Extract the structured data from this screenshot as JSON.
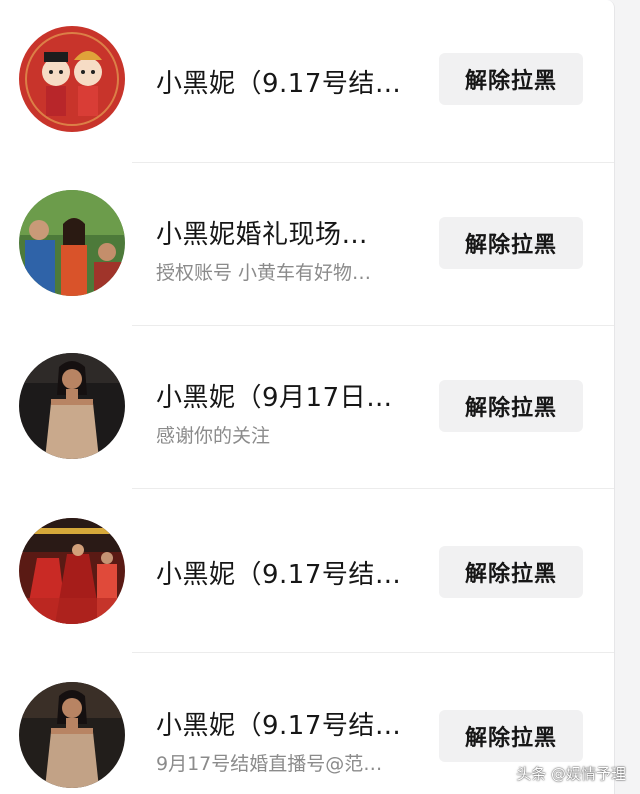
{
  "block_list": {
    "items": [
      {
        "name": "小黑妮（9.17号结…",
        "subtitle": "",
        "button": "解除拉黑"
      },
      {
        "name": "小黑妮婚礼现场…",
        "subtitle": "授权账号 小黄车有好物…",
        "button": "解除拉黑"
      },
      {
        "name": "小黑妮（9月17日…",
        "subtitle": "感谢你的关注",
        "button": "解除拉黑"
      },
      {
        "name": "小黑妮（9.17号结…",
        "subtitle": "",
        "button": "解除拉黑"
      },
      {
        "name": "小黑妮（9.17号结…",
        "subtitle": "9月17号结婚直播号@范…",
        "button": "解除拉黑"
      }
    ]
  },
  "watermark": "头条 @娱情予理",
  "colors": {
    "background": "#ffffff",
    "button_bg": "#f1f1f2",
    "name_text": "#161616",
    "subtitle_text": "#8b8b8b"
  }
}
